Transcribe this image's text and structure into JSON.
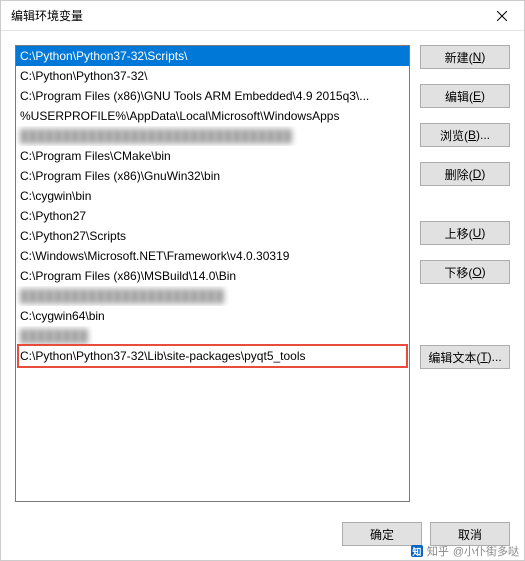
{
  "title": "编辑环境变量",
  "list": {
    "items": [
      {
        "text": "C:\\Python\\Python37-32\\Scripts\\",
        "selected": true
      },
      {
        "text": "C:\\Python\\Python37-32\\"
      },
      {
        "text": "C:\\Program Files (x86)\\GNU Tools ARM Embedded\\4.9 2015q3\\..."
      },
      {
        "text": "%USERPROFILE%\\AppData\\Local\\Microsoft\\WindowsApps"
      },
      {
        "text": "████████████████████████████████",
        "blurred": true
      },
      {
        "text": "C:\\Program Files\\CMake\\bin"
      },
      {
        "text": "C:\\Program Files (x86)\\GnuWin32\\bin"
      },
      {
        "text": "C:\\cygwin\\bin"
      },
      {
        "text": "C:\\Python27"
      },
      {
        "text": "C:\\Python27\\Scripts"
      },
      {
        "text": "C:\\Windows\\Microsoft.NET\\Framework\\v4.0.30319"
      },
      {
        "text": "C:\\Program Files (x86)\\MSBuild\\14.0\\Bin"
      },
      {
        "text": "████████████████████████",
        "blurred": true
      },
      {
        "text": "C:\\cygwin64\\bin"
      },
      {
        "text": "████████",
        "blurred": true
      },
      {
        "text": "C:\\Python\\Python37-32\\Lib\\site-packages\\pyqt5_tools",
        "highlighted": true
      }
    ]
  },
  "buttons": {
    "new": {
      "label": "新建(",
      "key": "N",
      "suffix": ")"
    },
    "edit": {
      "label": "编辑(",
      "key": "E",
      "suffix": ")"
    },
    "browse": {
      "label": "浏览(",
      "key": "B",
      "suffix": ")..."
    },
    "delete": {
      "label": "删除(",
      "key": "D",
      "suffix": ")"
    },
    "moveup": {
      "label": "上移(",
      "key": "U",
      "suffix": ")"
    },
    "movedown": {
      "label": "下移(",
      "key": "O",
      "suffix": ")"
    },
    "edittext": {
      "label": "编辑文本(",
      "key": "T",
      "suffix": ")..."
    },
    "ok": "确定",
    "cancel": "取消"
  },
  "watermark": {
    "brand": "知乎",
    "user": "@小仆街多哒"
  }
}
